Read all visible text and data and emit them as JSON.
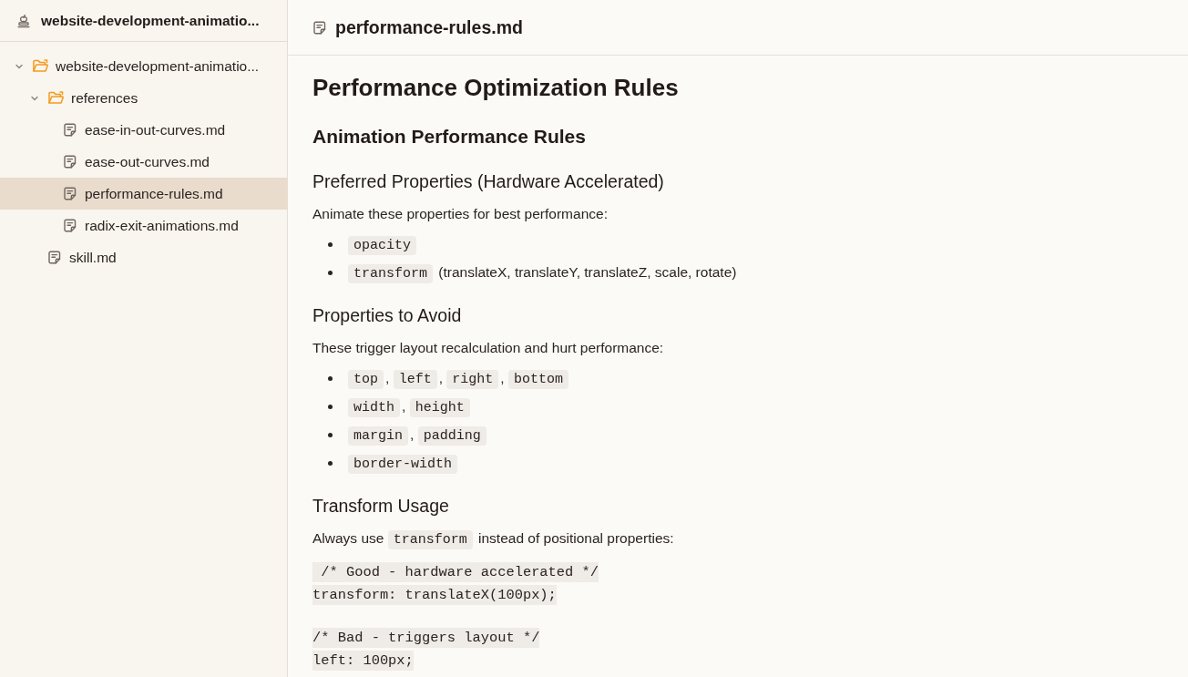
{
  "sidebar": {
    "title": "website-development-animatio...",
    "tree": [
      {
        "kind": "folder",
        "label": "website-development-animatio...",
        "expanded": true,
        "selected": false,
        "children": [
          {
            "kind": "folder",
            "label": "references",
            "expanded": true,
            "selected": false,
            "children": [
              {
                "kind": "file",
                "label": "ease-in-out-curves.md",
                "selected": false
              },
              {
                "kind": "file",
                "label": "ease-out-curves.md",
                "selected": false
              },
              {
                "kind": "file",
                "label": "performance-rules.md",
                "selected": true
              },
              {
                "kind": "file",
                "label": "radix-exit-animations.md",
                "selected": false
              }
            ]
          },
          {
            "kind": "file",
            "label": "skill.md",
            "selected": false
          }
        ]
      }
    ]
  },
  "editor": {
    "file_name": "performance-rules.md",
    "blocks": [
      {
        "kind": "h1",
        "text": "Performance Optimization Rules"
      },
      {
        "kind": "h2",
        "text": "Animation Performance Rules"
      },
      {
        "kind": "h3",
        "text": "Preferred Properties (Hardware Accelerated)"
      },
      {
        "kind": "p",
        "parts": [
          {
            "kind": "text",
            "text": "Animate these properties for best performance:"
          }
        ]
      },
      {
        "kind": "ul",
        "items": [
          {
            "parts": [
              {
                "kind": "code",
                "text": "opacity"
              }
            ]
          },
          {
            "parts": [
              {
                "kind": "code",
                "text": "transform"
              },
              {
                "kind": "text",
                "text": " (translateX, translateY, translateZ, scale, rotate)"
              }
            ]
          }
        ]
      },
      {
        "kind": "h3",
        "text": "Properties to Avoid"
      },
      {
        "kind": "p",
        "parts": [
          {
            "kind": "text",
            "text": "These trigger layout recalculation and hurt performance:"
          }
        ]
      },
      {
        "kind": "ul",
        "items": [
          {
            "parts": [
              {
                "kind": "code",
                "text": "top"
              },
              {
                "kind": "text",
                "text": ", "
              },
              {
                "kind": "code",
                "text": "left"
              },
              {
                "kind": "text",
                "text": ", "
              },
              {
                "kind": "code",
                "text": "right"
              },
              {
                "kind": "text",
                "text": ", "
              },
              {
                "kind": "code",
                "text": "bottom"
              }
            ]
          },
          {
            "parts": [
              {
                "kind": "code",
                "text": "width"
              },
              {
                "kind": "text",
                "text": ", "
              },
              {
                "kind": "code",
                "text": "height"
              }
            ]
          },
          {
            "parts": [
              {
                "kind": "code",
                "text": "margin"
              },
              {
                "kind": "text",
                "text": ", "
              },
              {
                "kind": "code",
                "text": "padding"
              }
            ]
          },
          {
            "parts": [
              {
                "kind": "code",
                "text": "border-width"
              }
            ]
          }
        ]
      },
      {
        "kind": "h3",
        "text": "Transform Usage"
      },
      {
        "kind": "p",
        "parts": [
          {
            "kind": "text",
            "text": "Always use "
          },
          {
            "kind": "code",
            "text": "transform"
          },
          {
            "kind": "text",
            "text": " instead of positional properties:"
          }
        ]
      },
      {
        "kind": "code",
        "groups": [
          {
            "lines": [
              " /* Good - hardware accelerated */",
              "transform: translateX(100px);"
            ]
          },
          {
            "lines": [
              "/* Bad - triggers layout */",
              "left: 100px;"
            ]
          }
        ]
      }
    ]
  }
}
